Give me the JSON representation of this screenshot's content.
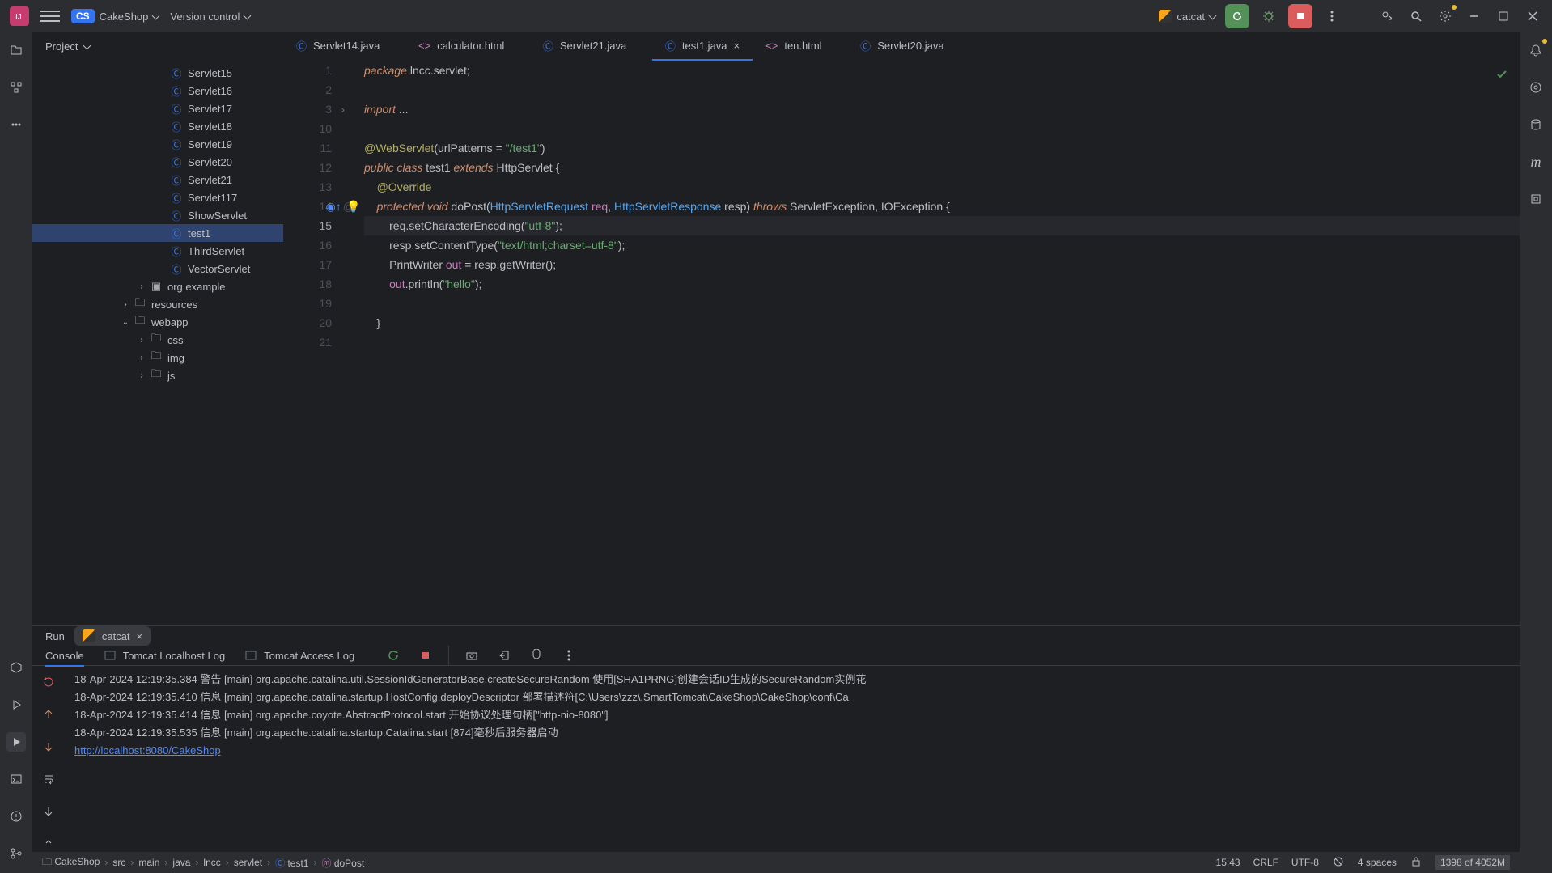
{
  "topbar": {
    "project": "CakeShop",
    "vcs": "Version control",
    "run_config": "catcat"
  },
  "project_tool": {
    "label": "Project"
  },
  "tree": {
    "classes": [
      "Servlet15",
      "Servlet16",
      "Servlet17",
      "Servlet18",
      "Servlet19",
      "Servlet20",
      "Servlet21",
      "Servlet117",
      "ShowServlet",
      "test1",
      "ThirdServlet",
      "VectorServlet"
    ],
    "selected": "test1",
    "pkg": "org.example",
    "res": "resources",
    "web": "webapp",
    "webs": [
      "css",
      "img",
      "js"
    ]
  },
  "tabs": [
    {
      "label": "Servlet14.java",
      "type": "java"
    },
    {
      "label": "calculator.html",
      "type": "html"
    },
    {
      "label": "Servlet21.java",
      "type": "java"
    },
    {
      "label": "test1.java",
      "type": "java",
      "active": true
    },
    {
      "label": "ten.html",
      "type": "html"
    },
    {
      "label": "Servlet20.java",
      "type": "java"
    }
  ],
  "code": {
    "lines": [
      {
        "n": 1,
        "tokens": [
          {
            "t": "package ",
            "c": "kw"
          },
          {
            "t": "lncc.servlet;",
            "c": ""
          }
        ]
      },
      {
        "n": 2,
        "tokens": []
      },
      {
        "n": 3,
        "fold": true,
        "tokens": [
          {
            "t": "import ",
            "c": "kw"
          },
          {
            "t": "...",
            "c": ""
          }
        ]
      },
      {
        "n": 10,
        "tokens": []
      },
      {
        "n": 11,
        "tokens": [
          {
            "t": "@WebServlet",
            "c": "ann"
          },
          {
            "t": "(urlPatterns = ",
            "c": ""
          },
          {
            "t": "\"/test1\"",
            "c": "str"
          },
          {
            "t": ")",
            "c": ""
          }
        ]
      },
      {
        "n": 12,
        "tokens": [
          {
            "t": "public class ",
            "c": "kw"
          },
          {
            "t": "test1 ",
            "c": ""
          },
          {
            "t": "extends ",
            "c": "kw"
          },
          {
            "t": "HttpServlet {",
            "c": ""
          }
        ]
      },
      {
        "n": 13,
        "tokens": [
          {
            "t": "    ",
            "c": ""
          },
          {
            "t": "@Override",
            "c": "ann"
          }
        ]
      },
      {
        "n": 14,
        "icons": true,
        "tokens": [
          {
            "t": "    ",
            "c": ""
          },
          {
            "t": "protected void ",
            "c": "kw"
          },
          {
            "t": "doPost(",
            "c": ""
          },
          {
            "t": "HttpServletRequest ",
            "c": "par"
          },
          {
            "t": "req",
            "c": "fld"
          },
          {
            "t": ", ",
            "c": ""
          },
          {
            "t": "HttpServletResponse ",
            "c": "par"
          },
          {
            "t": "resp",
            "c": ""
          },
          {
            "t": ") ",
            "c": ""
          },
          {
            "t": "throws ",
            "c": "kw"
          },
          {
            "t": "ServletException, IOException {",
            "c": ""
          }
        ]
      },
      {
        "n": 15,
        "cur": true,
        "tokens": [
          {
            "t": "        req.setCharacterEncoding(",
            "c": ""
          },
          {
            "t": "\"utf-8\"",
            "c": "str"
          },
          {
            "t": ");",
            "c": ""
          }
        ]
      },
      {
        "n": 16,
        "tokens": [
          {
            "t": "        resp.setContentType(",
            "c": ""
          },
          {
            "t": "\"text/html;charset=utf-8\"",
            "c": "str"
          },
          {
            "t": ");",
            "c": ""
          }
        ]
      },
      {
        "n": 17,
        "tokens": [
          {
            "t": "        PrintWriter ",
            "c": ""
          },
          {
            "t": "out",
            "c": "fld"
          },
          {
            "t": " = resp.getWriter();",
            "c": ""
          }
        ]
      },
      {
        "n": 18,
        "tokens": [
          {
            "t": "        ",
            "c": ""
          },
          {
            "t": "out",
            "c": "fld"
          },
          {
            "t": ".println(",
            "c": ""
          },
          {
            "t": "\"hello\"",
            "c": "str"
          },
          {
            "t": ");",
            "c": ""
          }
        ]
      },
      {
        "n": 19,
        "tokens": []
      },
      {
        "n": 20,
        "tokens": [
          {
            "t": "    }",
            "c": ""
          }
        ]
      },
      {
        "n": 21,
        "tokens": []
      }
    ]
  },
  "run": {
    "label": "Run",
    "config": "catcat",
    "subtabs": [
      "Console",
      "Tomcat Localhost Log",
      "Tomcat Access Log"
    ],
    "lines": [
      "18-Apr-2024 12:19:35.384 警告 [main] org.apache.catalina.util.SessionIdGeneratorBase.createSecureRandom 使用[SHA1PRNG]创建会话ID生成的SecureRandom实例花",
      "18-Apr-2024 12:19:35.410 信息 [main] org.apache.catalina.startup.HostConfig.deployDescriptor 部署描述符[C:\\Users\\zzz\\.SmartTomcat\\CakeShop\\CakeShop\\conf\\Ca",
      "18-Apr-2024 12:19:35.414 信息 [main] org.apache.coyote.AbstractProtocol.start 开始协议处理句柄[\"http-nio-8080\"]",
      "18-Apr-2024 12:19:35.535 信息 [main] org.apache.catalina.startup.Catalina.start [874]毫秒后服务器启动"
    ],
    "url": "http://localhost:8080/CakeShop"
  },
  "crumbs": [
    "CakeShop",
    "src",
    "main",
    "java",
    "lncc",
    "servlet",
    "test1",
    "doPost"
  ],
  "status": {
    "pos": "15:43",
    "eol": "CRLF",
    "enc": "UTF-8",
    "indent": "4 spaces",
    "mem": "1398 of 4052M"
  }
}
